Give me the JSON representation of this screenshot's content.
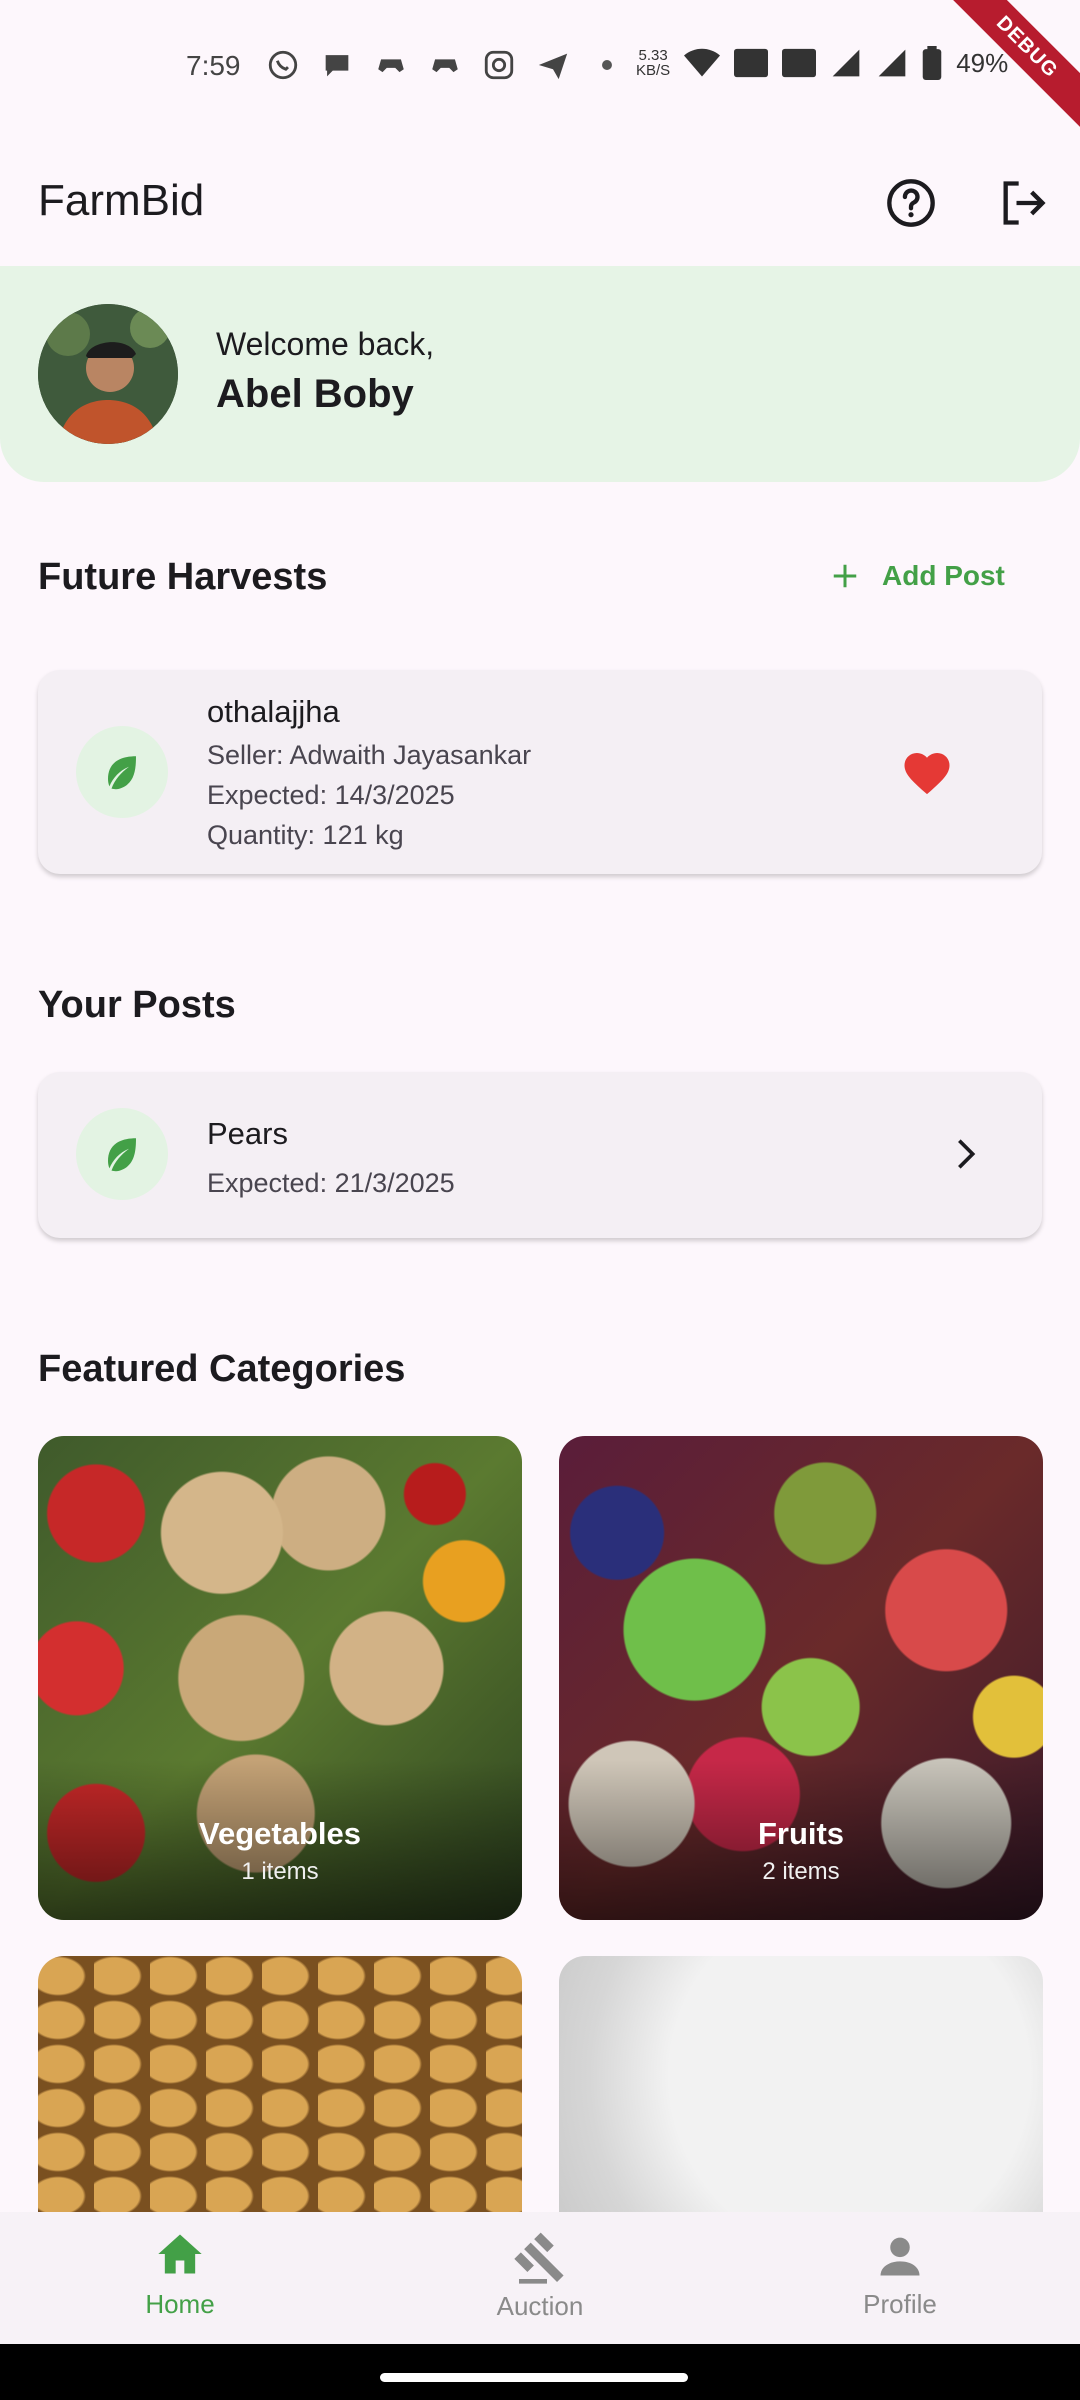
{
  "status_bar": {
    "time": "7:59",
    "net_speed_value": "5.33",
    "net_speed_unit": "KB/S",
    "battery": "49%",
    "debug_label": "DEBUG"
  },
  "app_bar": {
    "title": "FarmBid",
    "help_icon": "help-circle-icon",
    "logout_icon": "logout-icon"
  },
  "welcome": {
    "greeting": "Welcome back,",
    "name": "Abel Boby"
  },
  "future_harvests": {
    "title": "Future Harvests",
    "add_post_label": "Add Post",
    "items": [
      {
        "name": "othalajjha",
        "seller": "Seller: Adwaith Jayasankar",
        "expected": "Expected: 14/3/2025",
        "quantity": "Quantity: 121 kg",
        "favorited": true
      }
    ]
  },
  "your_posts": {
    "title": "Your Posts",
    "items": [
      {
        "name": "Pears",
        "expected": "Expected: 21/3/2025"
      }
    ]
  },
  "featured_categories": {
    "title": "Featured Categories",
    "items": [
      {
        "name": "Vegetables",
        "count": "1 items"
      },
      {
        "name": "Fruits",
        "count": "2 items"
      },
      {
        "name": "",
        "count": ""
      },
      {
        "name": "",
        "count": ""
      }
    ]
  },
  "bottom_nav": {
    "items": [
      {
        "label": "Home",
        "icon": "home-icon",
        "active": true
      },
      {
        "label": "Auction",
        "icon": "gavel-icon",
        "active": false
      },
      {
        "label": "Profile",
        "icon": "person-icon",
        "active": false
      }
    ]
  },
  "colors": {
    "accent": "#43a047",
    "welcome_bg": "#e6f4e6",
    "heart": "#e53935",
    "page_bg": "#fdf7fc"
  }
}
